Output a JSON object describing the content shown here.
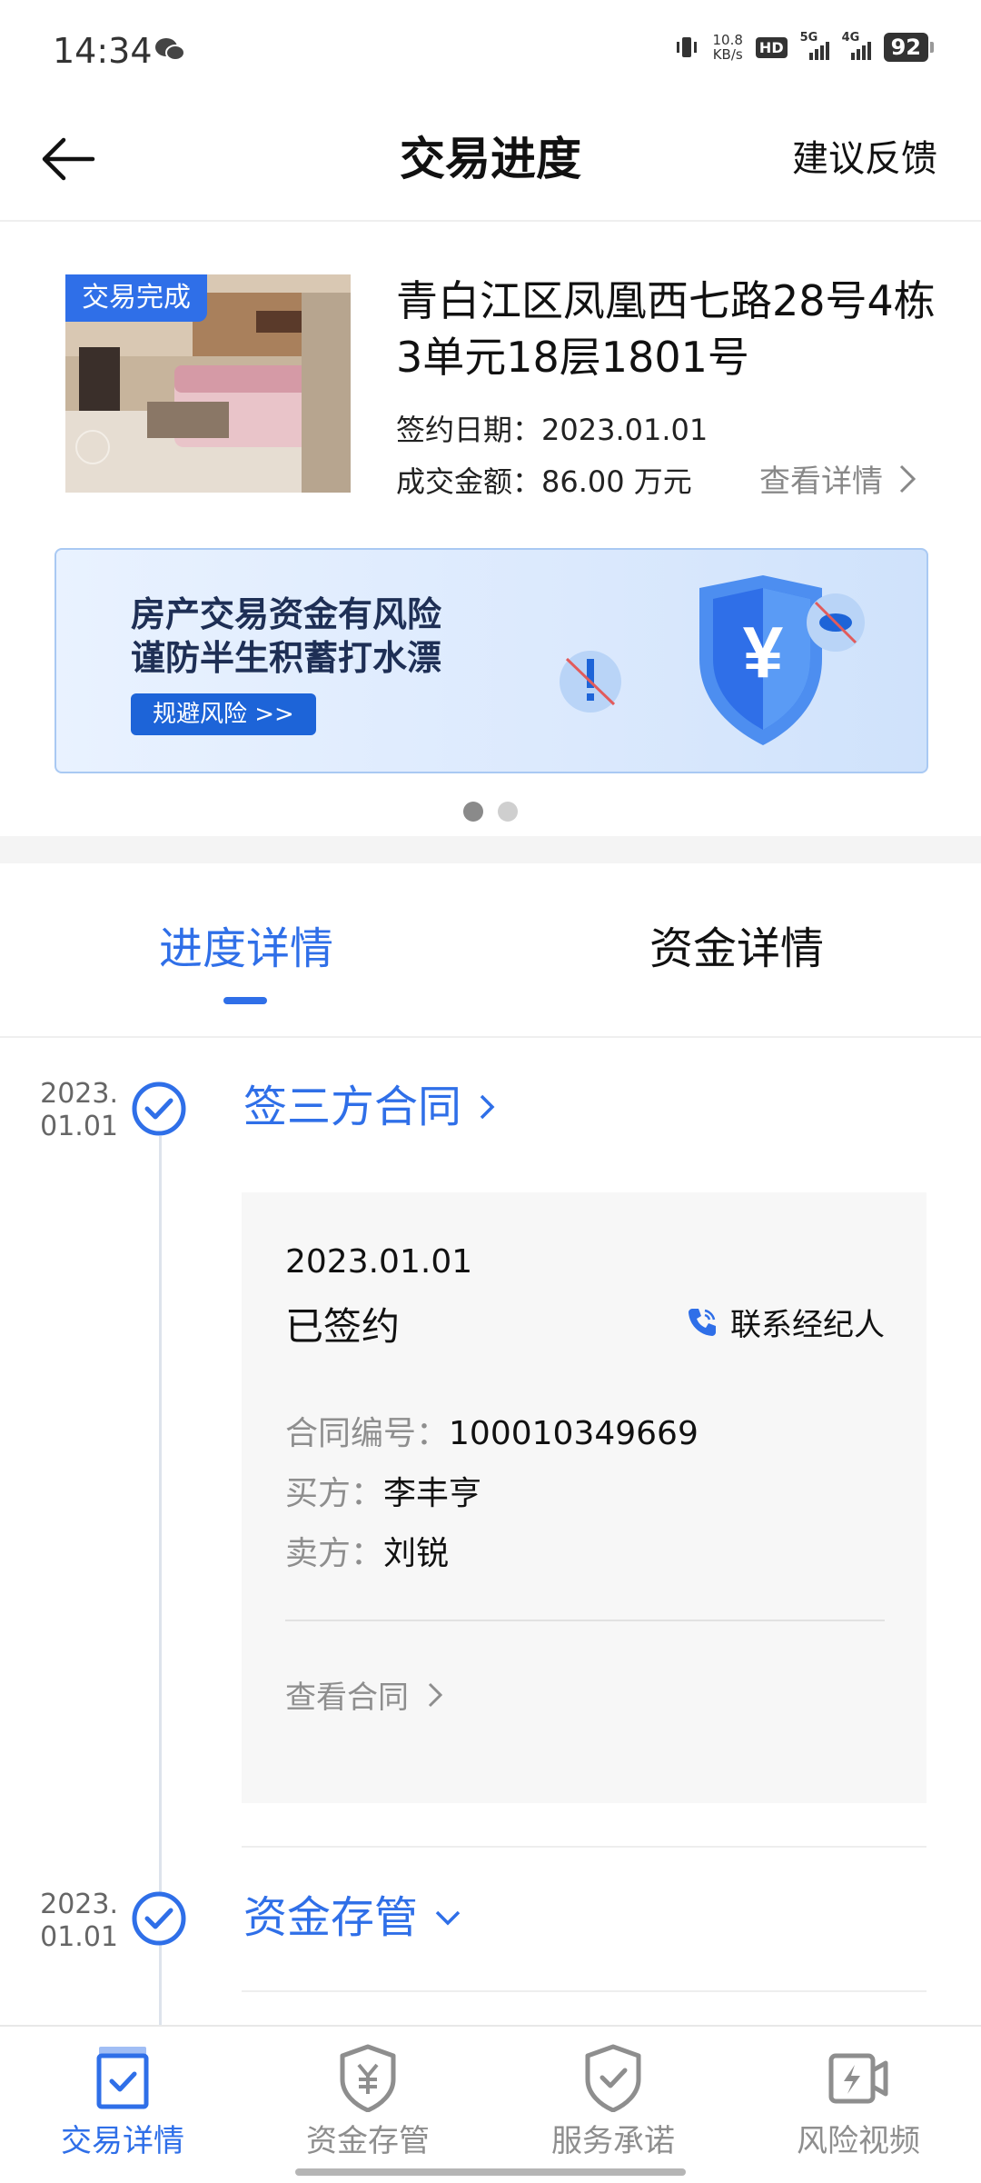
{
  "status_bar": {
    "time": "14:34",
    "net_speed_value": "10.8",
    "net_speed_unit": "KB/s",
    "hd": "HD",
    "sim1": "5G",
    "sim2": "4G",
    "battery": "92"
  },
  "header": {
    "title": "交易进度",
    "feedback": "建议反馈"
  },
  "property": {
    "badge": "交易完成",
    "address": "青白江区凤凰西七路28号4栋3单元18层1801号",
    "sign_date": "签约日期：2023.01.01",
    "price": "成交金额：86.00 万元",
    "detail_link": "查看详情"
  },
  "banner": {
    "line1": "房产交易资金有风险",
    "line2": "谨防半生积蓄打水漂",
    "button": "规避风险 >>"
  },
  "tabs": [
    {
      "label": "进度详情",
      "active": true
    },
    {
      "label": "资金详情",
      "active": false
    }
  ],
  "timeline": [
    {
      "date_line1": "2023.",
      "date_line2": "01.01",
      "title": "签三方合同",
      "card": {
        "date": "2023.01.01",
        "status": "已签约",
        "contact": "联系经纪人",
        "contract_label": "合同编号：",
        "contract_no": "100010349669",
        "buyer_label": "买方：",
        "buyer": "李丰亨",
        "seller_label": "卖方：",
        "seller": "刘锐",
        "view_contract": "查看合同"
      }
    },
    {
      "date_line1": "2023.",
      "date_line2": "01.01",
      "title": "资金存管"
    }
  ],
  "bottom_nav": [
    {
      "label": "交易详情",
      "icon": "clipboard-check-icon",
      "active": true
    },
    {
      "label": "资金存管",
      "icon": "shield-yuan-icon",
      "active": false
    },
    {
      "label": "服务承诺",
      "icon": "shield-check-icon",
      "active": false
    },
    {
      "label": "风险视频",
      "icon": "video-flash-icon",
      "active": false
    }
  ],
  "colors": {
    "accent": "#2f6fe8",
    "text": "#111111",
    "muted": "#8e8e8e"
  }
}
